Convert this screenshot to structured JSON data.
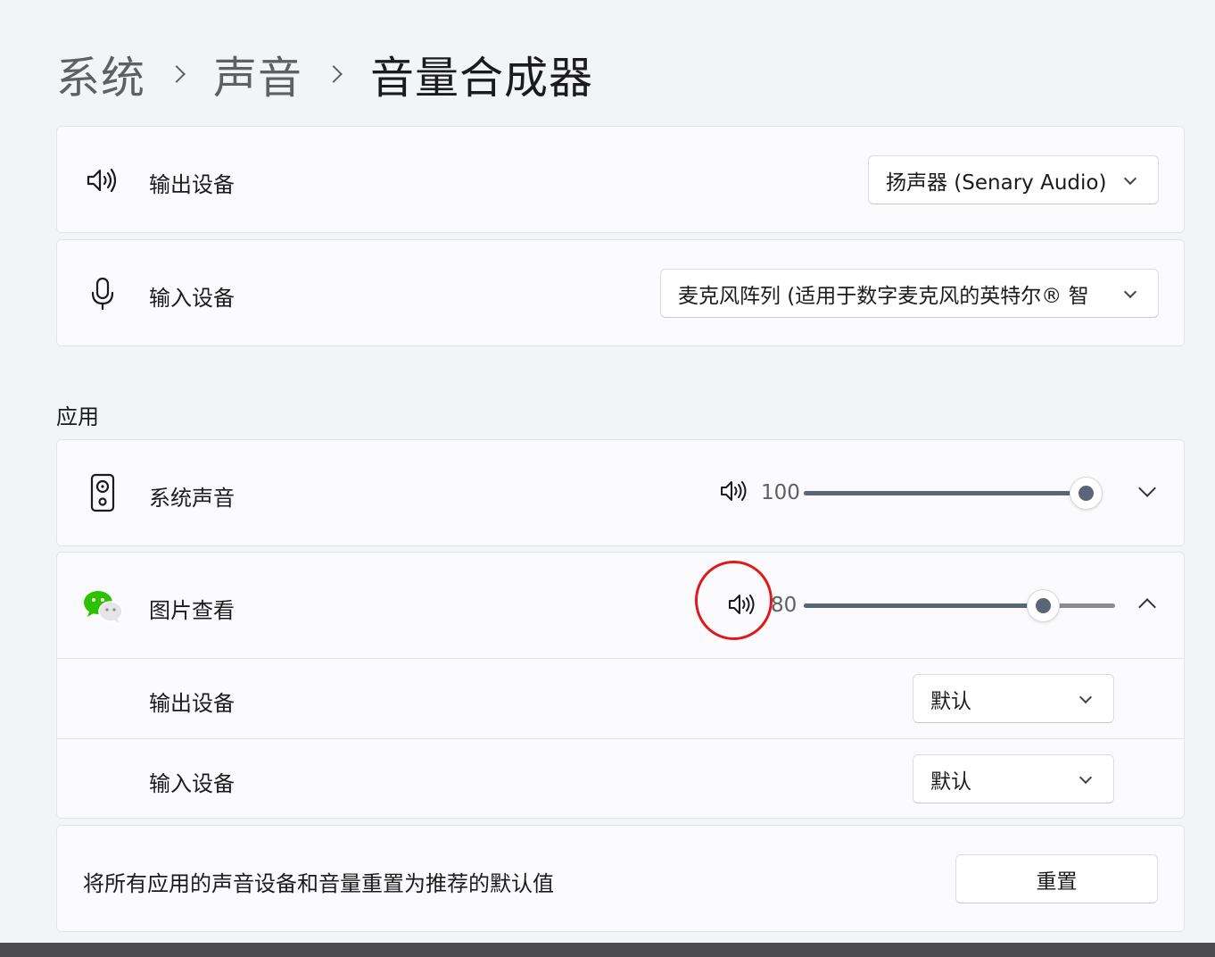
{
  "breadcrumb": {
    "items": [
      "系统",
      "声音",
      "音量合成器"
    ]
  },
  "output_device": {
    "label": "输出设备",
    "icon": "speaker-icon",
    "selected": "扬声器 (Senary Audio)"
  },
  "input_device": {
    "label": "输入设备",
    "icon": "microphone-icon",
    "selected": "麦克风阵列 (适用于数字麦克风的英特尔® 智"
  },
  "apps_section": {
    "title": "应用",
    "apps": [
      {
        "name": "系统声音",
        "icon": "system-sounds-icon",
        "volume": "100",
        "level_percent": 100,
        "expanded": false
      },
      {
        "name": "图片查看",
        "icon": "wechat-icon",
        "volume": "80",
        "level_percent": 80,
        "expanded": true,
        "output_label": "输出设备",
        "output_selected": "默认",
        "input_label": "输入设备",
        "input_selected": "默认"
      }
    ]
  },
  "reset": {
    "description": "将所有应用的声音设备和音量重置为推荐的默认值",
    "button_label": "重置"
  },
  "colors": {
    "accent": "#5a6577",
    "annotation": "#e0191c",
    "background": "#f3f4f7",
    "card": "#fbfbfd"
  }
}
